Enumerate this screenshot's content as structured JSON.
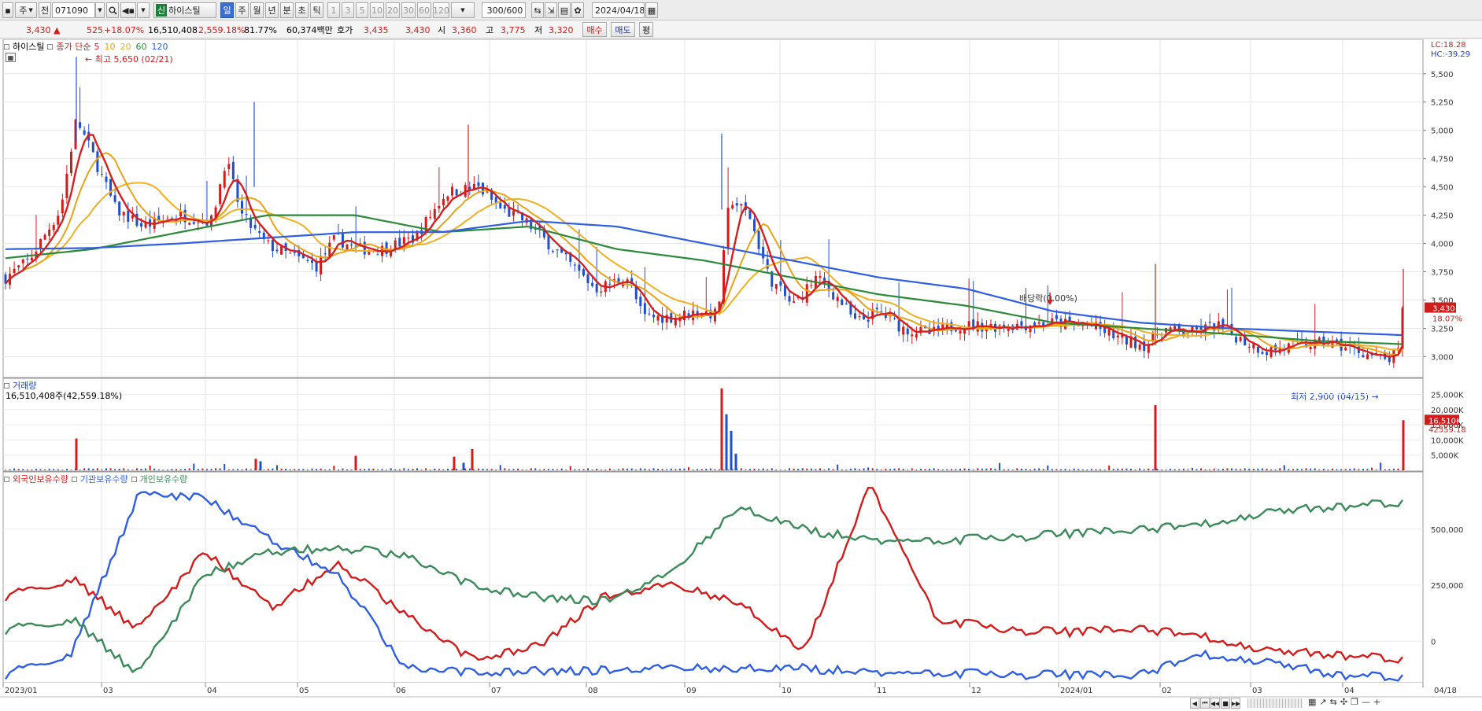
{
  "toolbar": {
    "period_primary": "주",
    "prev_label": "전",
    "code": "071090",
    "badge_new": "신",
    "stock_name": "하이스틸",
    "tabs": [
      {
        "label": "일",
        "selected": true
      },
      {
        "label": "주",
        "selected": false
      },
      {
        "label": "월",
        "selected": false
      },
      {
        "label": "년",
        "selected": false
      },
      {
        "label": "분",
        "selected": false
      },
      {
        "label": "초",
        "selected": false
      },
      {
        "label": "틱",
        "selected": false
      }
    ],
    "intervals": [
      "1",
      "3",
      "5",
      "10",
      "20",
      "30",
      "60",
      "120"
    ],
    "count": "300/600",
    "date": "2024/04/18"
  },
  "quote": {
    "price": "3,430",
    "change": "525",
    "rate": "+18.07%",
    "volume": "16,510,408",
    "volume_ratio": "2,559.18%",
    "turnover": "81.77%",
    "amount": "60,374백만",
    "hoga_label": "호가",
    "ask": "3,435",
    "bid": "3,430",
    "open_label": "시",
    "open": "3,360",
    "high_label": "고",
    "high": "3,775",
    "low_label": "저",
    "low": "3,320",
    "buy_label": "매수",
    "sell_label": "매도",
    "eval_label": "평"
  },
  "price_panel": {
    "name_label": "하이스틸",
    "legend_title": "종가 단순",
    "ma_labels": [
      "5",
      "10",
      "20",
      "60",
      "120"
    ],
    "ma_colors": [
      "#d42020",
      "#e8a317",
      "#f0b020",
      "#2a8a3a",
      "#2f5fe0"
    ],
    "lc_label": "LC:18.28",
    "hc_label": "HC:-39.29",
    "high_annotation": "최고 5,650 (02/21)",
    "low_annotation": "최저 2,900 (04/15)",
    "dividend_annotation": "배당락(0.00%)",
    "last_price_tag": "3,430",
    "last_rate_tag": "18.07%",
    "y_ticks": [
      "5,500",
      "5,250",
      "5,000",
      "4,750",
      "4,500",
      "4,250",
      "4,000",
      "3,750",
      "3,500",
      "3,250",
      "3,000"
    ]
  },
  "volume_panel": {
    "title": "거래량",
    "subtitle": "16,510,408주(42,559.18%)",
    "y_ticks": [
      "25,000K",
      "20,000K",
      "15,000K",
      "10,000K",
      "5,000K"
    ],
    "last_tag": "16,510K",
    "last_sub_tag": "42559.18"
  },
  "holding_panel": {
    "labels": [
      "외국인보유수량",
      "기관보유수량",
      "개인보유수량"
    ],
    "colors": [
      "#d21b1b",
      "#2f5fe0",
      "#3a8a5a"
    ],
    "y_ticks": [
      "500,000",
      "250,000",
      "0"
    ]
  },
  "x_axis": [
    "2023/01",
    "03",
    "04",
    "05",
    "06",
    "07",
    "08",
    "09",
    "10",
    "11",
    "12",
    "2024/01",
    "02",
    "03",
    "04",
    "04/18"
  ],
  "chart_data": {
    "type": "line",
    "title": "하이스틸",
    "ylim": [
      2850,
      5700
    ],
    "x": [
      "2023/01",
      "02/21",
      "03",
      "04",
      "05",
      "06",
      "07",
      "08",
      "09",
      "10",
      "11",
      "12",
      "2024/01",
      "02",
      "03",
      "04/15",
      "04/18"
    ],
    "series": [
      {
        "name": "5",
        "values": [
          3700,
          4700,
          4500,
          4250,
          3950,
          4000,
          4400,
          3700,
          3400,
          3800,
          3300,
          3270,
          3280,
          3150,
          3050,
          2950,
          3060
        ]
      },
      {
        "name": "60",
        "values": [
          3870,
          3950,
          4100,
          4250,
          4250,
          4100,
          4150,
          3950,
          3850,
          3700,
          3550,
          3450,
          3300,
          3250,
          3200,
          3140,
          3110
        ]
      },
      {
        "name": "120",
        "values": [
          3950,
          3960,
          4000,
          4050,
          4100,
          4100,
          4200,
          4150,
          4000,
          3850,
          3700,
          3600,
          3400,
          3300,
          3250,
          3220,
          3190
        ]
      }
    ]
  }
}
